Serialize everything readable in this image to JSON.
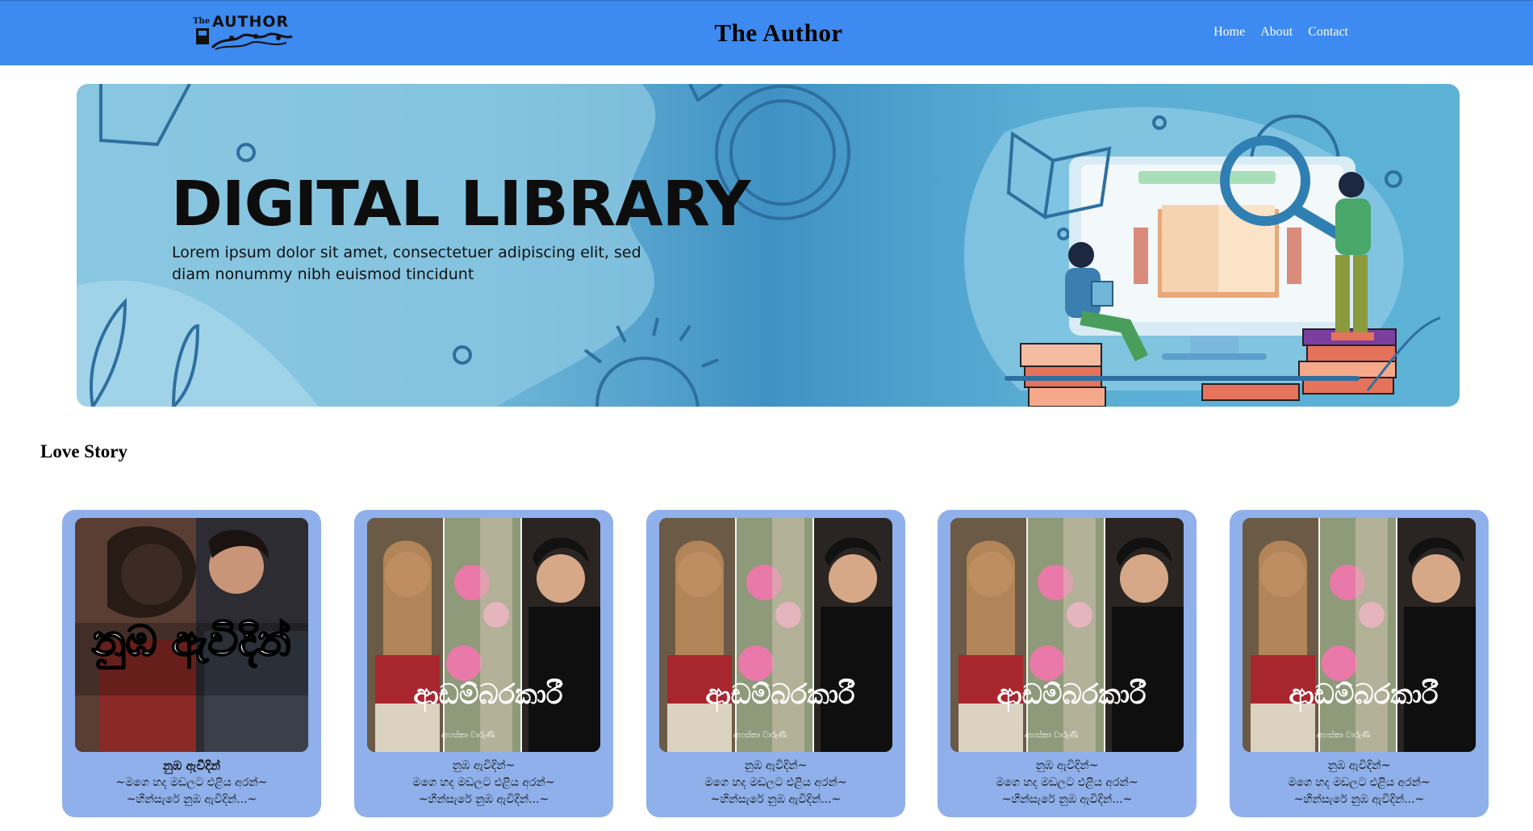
{
  "header": {
    "logo_text": "The AUTHOR",
    "brand": "The Author",
    "nav": [
      {
        "label": "Home"
      },
      {
        "label": "About"
      },
      {
        "label": "Contact"
      }
    ]
  },
  "banner": {
    "title": "DIGITAL LIBRARY",
    "subtitle": "Lorem ipsum dolor sit amet, consectetuer adipiscing elit, sed diam nonummy nibh euismod tincidunt"
  },
  "section": {
    "title": "Love Story"
  },
  "cards": [
    {
      "cover_title": "නුඹ ඇවිදින්",
      "cover_author": "",
      "line1": "නුඹ ඇවිදින්",
      "line2": "~මගෙ හද මඩලට එළිය අරන්~",
      "line3": "~හීන්සැරේ නුඹ ඇවිදින්...~"
    },
    {
      "cover_title": "ආඩම්බරකාරී",
      "cover_author": "අහස්කා වාරුණී",
      "line1": "නුඹ ඇවිදින්~",
      "line2": "මගෙ හද මඩලට එළිය අරන්~",
      "line3": "~හීන්සැරේ නුඹ ඇවිදින්...~"
    },
    {
      "cover_title": "ආඩම්බරකාරී",
      "cover_author": "අහස්කා වාරුණී",
      "line1": "නුඹ ඇවිදින්~",
      "line2": "මගෙ හද මඩලට එළිය අරන්~",
      "line3": "~හීන්සැරේ නුඹ ඇවිදින්...~"
    },
    {
      "cover_title": "ආඩම්බරකාරී",
      "cover_author": "අහස්කා වාරුණී",
      "line1": "නුඹ ඇවිදින්~",
      "line2": "මගෙ හද මඩලට එළිය අරන්~",
      "line3": "~හීන්සැරේ නුඹ ඇවිදින්...~"
    },
    {
      "cover_title": "ආඩම්බරකාරී",
      "cover_author": "අහස්කා වාරුණී",
      "line1": "නුඹ ඇවිදින්~",
      "line2": "මගෙ හද මඩලට එළිය අරන්~",
      "line3": "~හීන්සැරේ නුඹ ඇවිදින්...~"
    }
  ],
  "colors": {
    "navbar": "#3d8af0",
    "card": "#8fb0ea"
  }
}
